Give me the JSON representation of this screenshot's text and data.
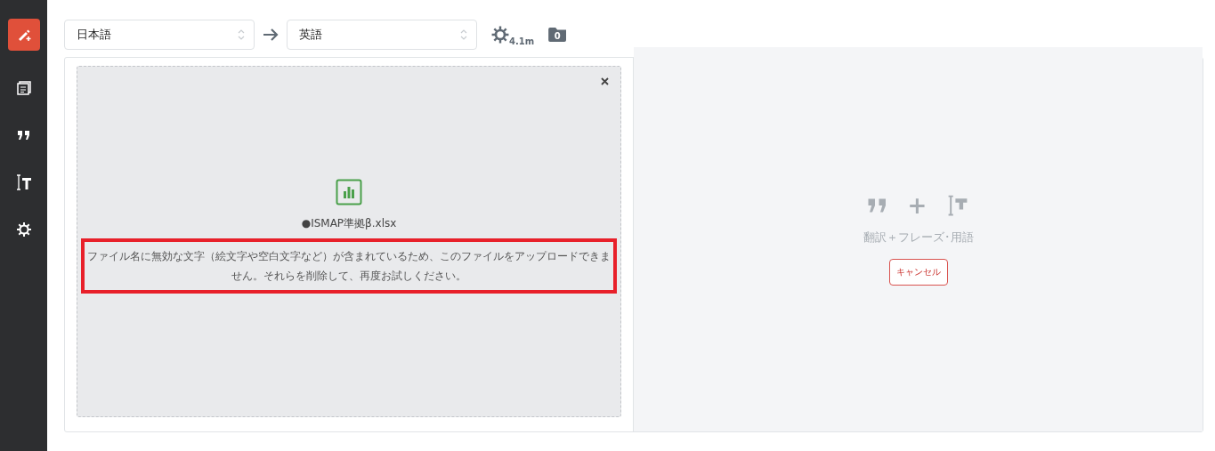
{
  "sidebar": {
    "items": [
      {
        "kind": "documents"
      },
      {
        "kind": "quote"
      },
      {
        "kind": "text"
      },
      {
        "kind": "settings"
      }
    ]
  },
  "toolbar": {
    "source_language": "日本語",
    "target_language": "英語",
    "usage": "4.1m",
    "folder_count": "0"
  },
  "upload": {
    "file_name": "●ISMAP準拠β.xlsx",
    "error": "ファイル名に無効な文字（絵文字や空白文字など）が含まれているため、このファイルをアップロードできません。それらを削除して、再度お試しください。",
    "error_highlighted": true
  },
  "target": {
    "plus": "+",
    "caption": "翻訳＋フレーズ･用語",
    "cancel": "キャンセル"
  }
}
